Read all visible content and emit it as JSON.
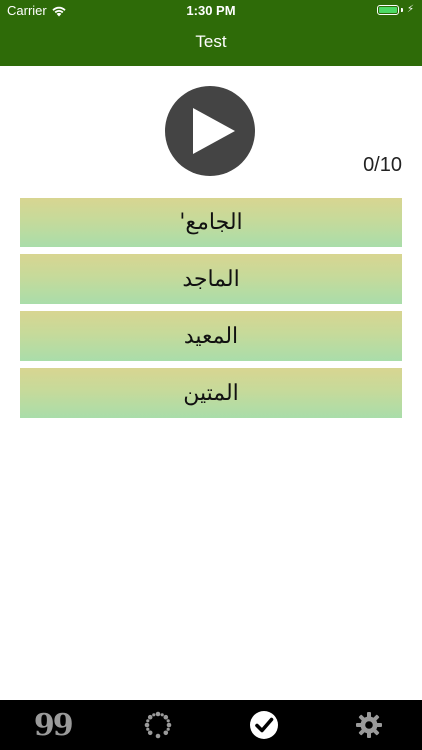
{
  "status_bar": {
    "carrier": "Carrier",
    "time": "1:30 PM",
    "wifi_icon": "wifi-icon",
    "battery_icon": "battery-icon",
    "charging_icon": "bolt-icon"
  },
  "nav": {
    "title": "Test"
  },
  "player": {
    "play_icon": "play-icon",
    "progress": "0/10"
  },
  "options": [
    {
      "label": "الجامع'"
    },
    {
      "label": "الماجد"
    },
    {
      "label": "المعيد"
    },
    {
      "label": "المتين"
    }
  ],
  "tabbar": {
    "tabs": [
      {
        "icon": "quotes-icon",
        "text": "99",
        "active": false
      },
      {
        "icon": "beads-icon",
        "active": false
      },
      {
        "icon": "checkmark-icon",
        "active": true
      },
      {
        "icon": "gear-icon",
        "active": false
      }
    ]
  },
  "colors": {
    "header_green": "#2e6b08",
    "option_top": "#d8d591",
    "option_bottom": "#a9ddaa",
    "play_button": "#444444",
    "tab_inactive": "#9a9a9a",
    "tab_active": "#ffffff"
  }
}
